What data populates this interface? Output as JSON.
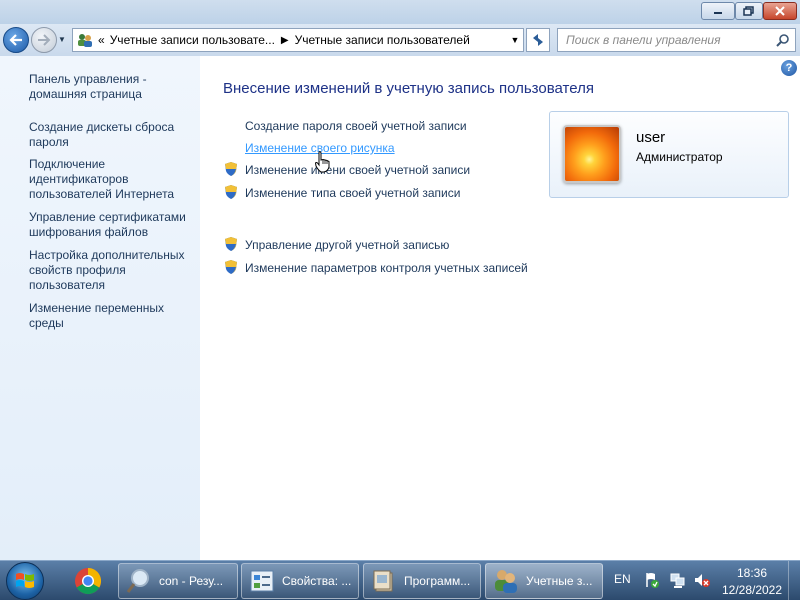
{
  "window": {
    "minimize_icon": "minimize-icon",
    "maximize_icon": "maximize-icon",
    "close_icon": "close-icon"
  },
  "nav": {
    "breadcrumb_sep": "«",
    "breadcrumb": [
      "Учетные записи пользовате...",
      "Учетные записи пользователей"
    ],
    "search_placeholder": "Поиск в панели управления"
  },
  "sidebar": {
    "items": [
      {
        "label": "Панель управления - домашняя страница"
      },
      {
        "label": "Создание дискеты сброса пароля"
      },
      {
        "label": "Подключение идентификаторов пользователей Интернета"
      },
      {
        "label": "Управление сертификатами шифрования файлов"
      },
      {
        "label": "Настройка дополнительных свойств профиля пользователя"
      },
      {
        "label": "Изменение переменных среды"
      }
    ]
  },
  "main": {
    "title": "Внесение изменений в учетную запись пользователя",
    "tasks": [
      {
        "label": "Создание пароля своей учетной записи",
        "shield": false
      },
      {
        "label": "Изменение своего рисунка",
        "shield": false,
        "hovered": true
      },
      {
        "label": "Изменение имени своей учетной записи",
        "shield": true
      },
      {
        "label": "Изменение типа своей учетной записи",
        "shield": true
      }
    ],
    "other_tasks": [
      {
        "label": "Управление другой учетной записью",
        "shield": true
      },
      {
        "label": "Изменение параметров контроля учетных записей",
        "shield": true
      }
    ]
  },
  "user": {
    "name": "user",
    "role": "Администратор"
  },
  "taskbar": {
    "items": [
      {
        "label": "con - Резу...",
        "icon": "magnifier-icon"
      },
      {
        "label": "Свойства: ...",
        "icon": "properties-icon"
      },
      {
        "label": "Программ...",
        "icon": "programs-icon"
      },
      {
        "label": "Учетные з...",
        "icon": "users-icon",
        "active": true
      }
    ],
    "lang": "EN",
    "time": "18:36",
    "date": "12/28/2022"
  },
  "colors": {
    "link": "#1e395b",
    "title": "#1e3287",
    "hover_link": "#3399ff",
    "sidebar_bg": "#eaf2fb"
  }
}
